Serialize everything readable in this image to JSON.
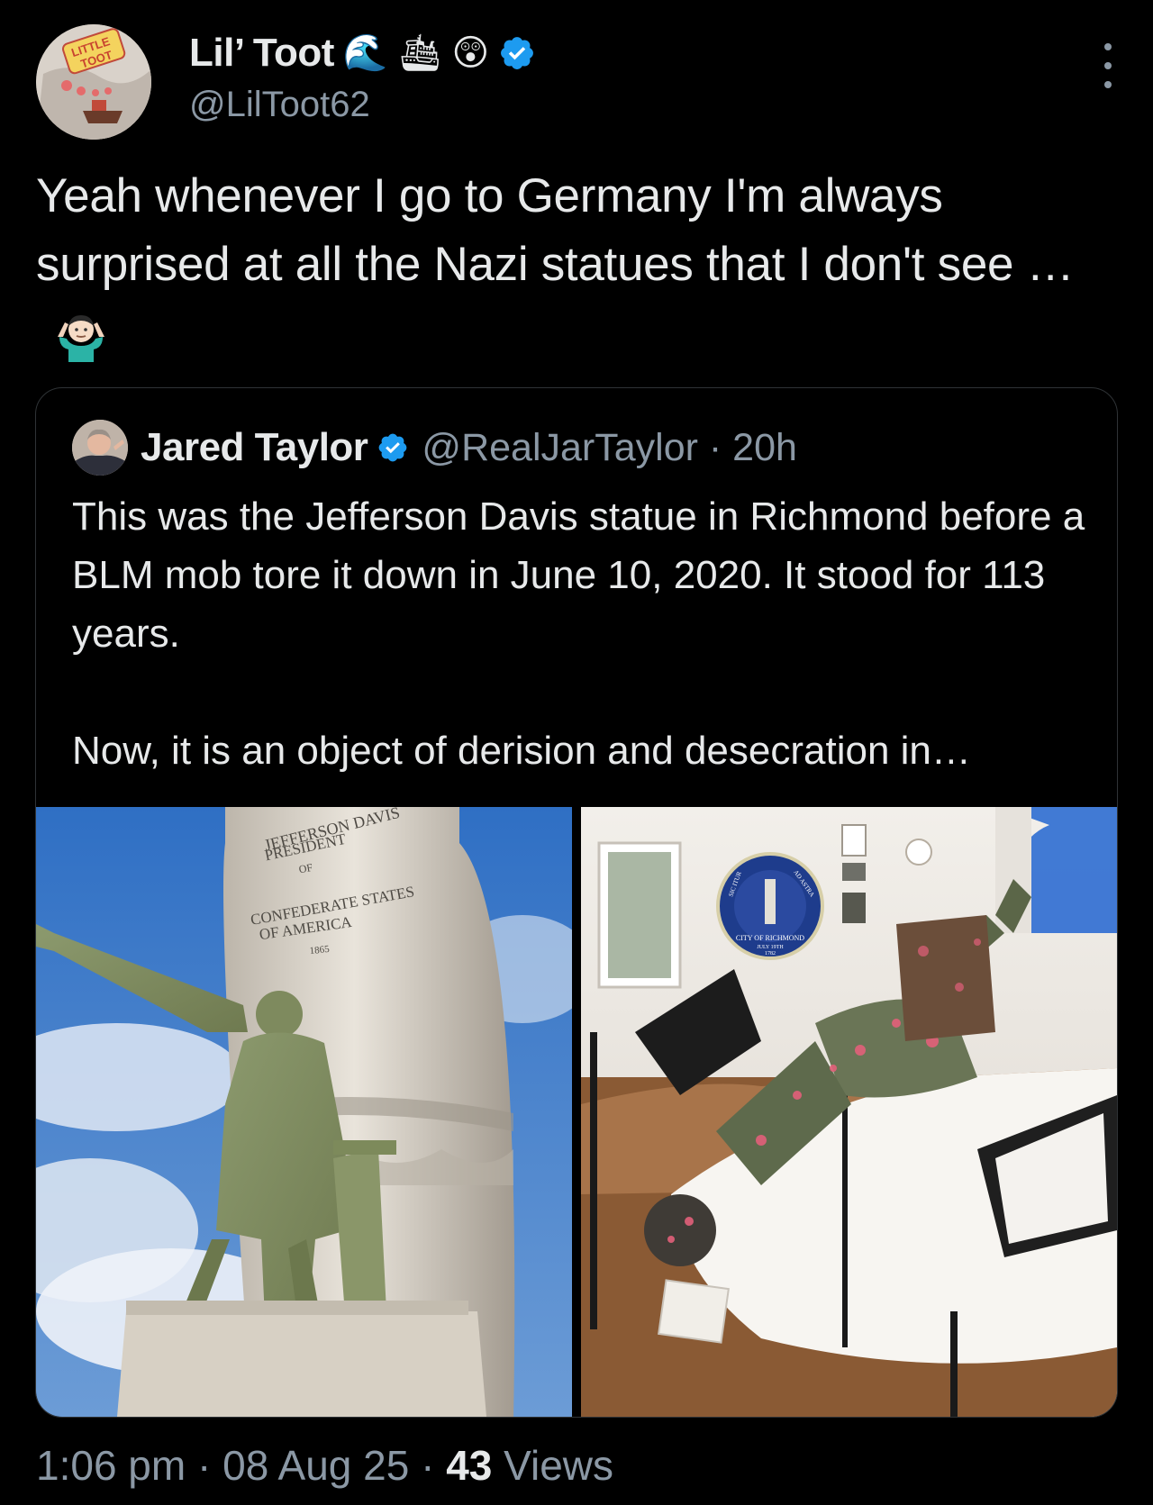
{
  "author": {
    "name": "Lil’ Toot",
    "name_emojis": [
      "🌊",
      "🛳",
      "😲"
    ],
    "handle": "@LilToot62",
    "verified": true,
    "avatar_label": "LITTLE TOOT"
  },
  "tweet": {
    "text": "Yeah whenever I go to Germany I'm always surprised at all the Nazi statues that I don't see …",
    "emoji_icon": "person-shrugging-icon"
  },
  "quoted": {
    "name": "Jared Taylor",
    "verified": true,
    "handle_time": "@RealJarTaylor · 20h",
    "body": "This was the Jefferson Davis statue in Richmond before a BLM mob tore it down in June 10, 2020. It stood for 113 years.\n\nNow, it is an object of derision and desecration in…",
    "images": {
      "left": {
        "inscription": [
          "JEFFERSON DAVIS",
          "PRESIDENT",
          "OF",
          "CONFEDERATE STATES",
          "OF AMERICA",
          "1865"
        ]
      },
      "right": {
        "seal_lines": [
          "SIC ITUR",
          "AD ASTRA",
          "CITY OF RICHMOND",
          "JULY 19TH",
          "1782"
        ]
      }
    }
  },
  "footer": {
    "time": "1:06 pm",
    "sep1": " · ",
    "date": "08 Aug 25",
    "sep2": " · ",
    "views_count": "43",
    "views_label": " Views"
  },
  "colors": {
    "background": "#000000",
    "text": "#e7e9ea",
    "secondary": "#8b98a5",
    "verified": "#1d9bf0",
    "border": "#2f3336"
  }
}
